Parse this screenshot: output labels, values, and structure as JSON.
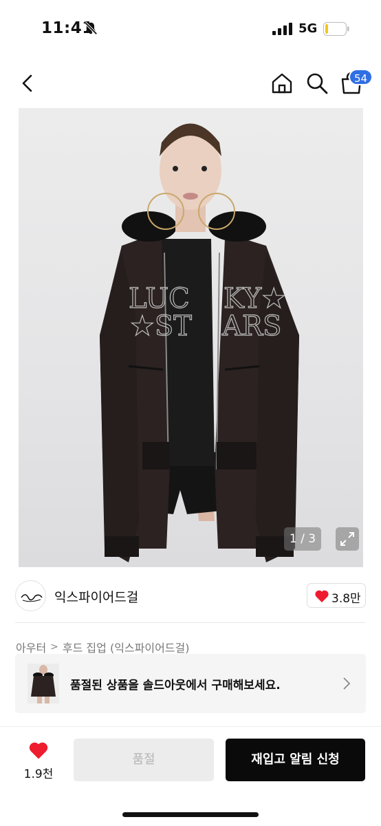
{
  "status_bar": {
    "time": "11:41",
    "network": "5G",
    "battery_level": 0.15,
    "battery_color": "#f5c518"
  },
  "header": {
    "cart_count": "54",
    "badge_color": "#2f6fe4"
  },
  "product_image": {
    "counter": "1 / 3"
  },
  "seller": {
    "name": "익스파이어드걸",
    "likes": "3.8만"
  },
  "breadcrumb": {
    "category": "아우터",
    "separator": ">",
    "subcategory": "후드 집업 (익스파이어드걸)"
  },
  "soldout_banner": {
    "text": "품절된 상품을 솔드아웃에서 구매해보세요."
  },
  "bottom_bar": {
    "wish_count": "1.9천",
    "soldout_label": "품절",
    "notify_label": "재입고 알림 신청"
  },
  "colors": {
    "heart": "#ee1c2e",
    "primary_button": "#0a0a0a"
  }
}
